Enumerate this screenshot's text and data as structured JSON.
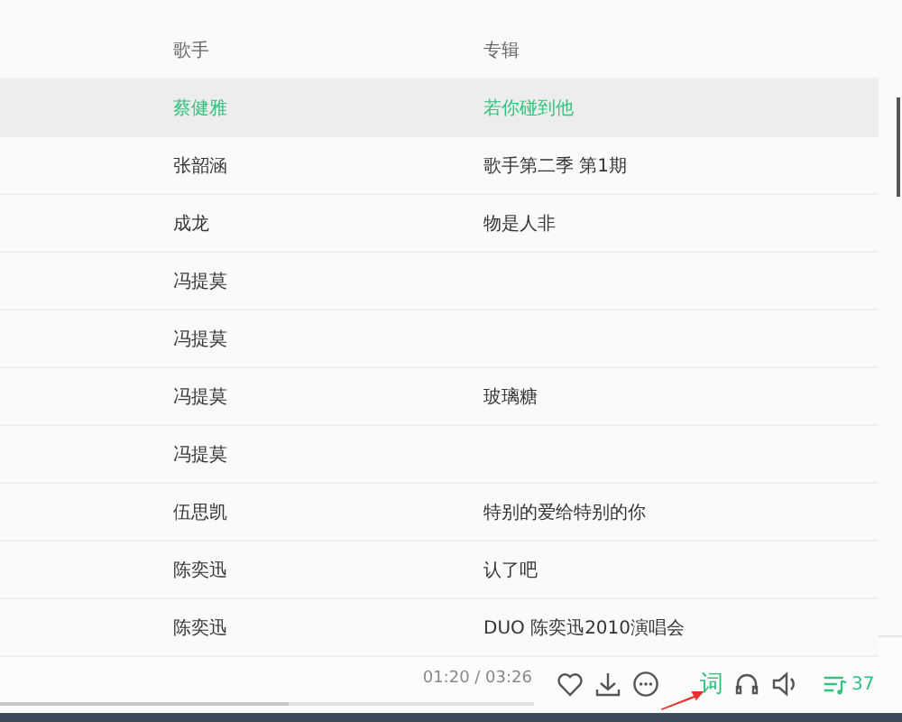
{
  "table": {
    "columns": [
      "歌手",
      "专辑"
    ],
    "rows": [
      {
        "singer": "蔡健雅",
        "album": "若你碰到他",
        "selected": true
      },
      {
        "singer": "张韶涵",
        "album": "歌手第二季 第1期",
        "selected": false
      },
      {
        "singer": "成龙",
        "album": "物是人非",
        "selected": false
      },
      {
        "singer": "冯提莫",
        "album": "",
        "selected": false
      },
      {
        "singer": "冯提莫",
        "album": "",
        "selected": false
      },
      {
        "singer": "冯提莫",
        "album": "玻璃糖",
        "selected": false
      },
      {
        "singer": "冯提莫",
        "album": "",
        "selected": false
      },
      {
        "singer": "伍思凯",
        "album": "特别的爱给特别的你",
        "selected": false
      },
      {
        "singer": "陈奕迅",
        "album": "认了吧",
        "selected": false
      },
      {
        "singer": "陈奕迅",
        "album": "DUO 陈奕迅2010演唱会",
        "selected": false
      }
    ]
  },
  "player": {
    "time": "01:20 / 03:26",
    "level": 0.54,
    "lyrics_button": "词",
    "lyrics_on": true,
    "playlist_count": "37"
  }
}
